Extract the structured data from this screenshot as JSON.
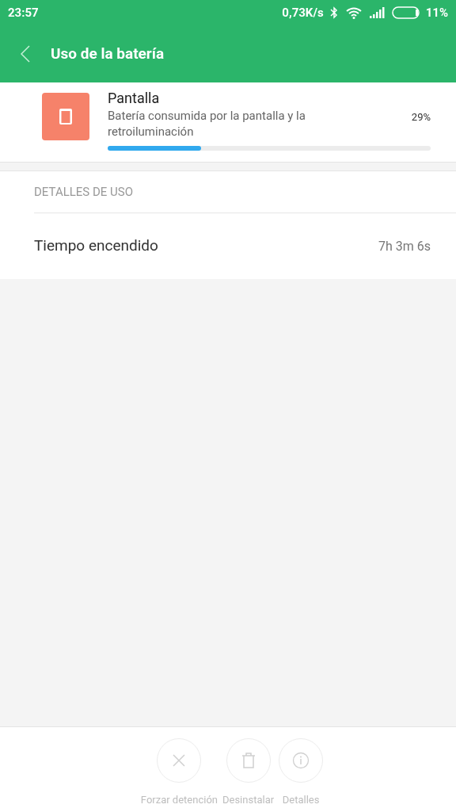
{
  "status_bar": {
    "time": "23:57",
    "speed": "0,73K/s",
    "battery": "11%"
  },
  "toolbar": {
    "title": "Uso de la batería"
  },
  "app": {
    "name": "Pantalla",
    "description": "Batería consumida por la pantalla y la retroiluminación",
    "percent": "29%",
    "level": 0.29
  },
  "details": {
    "heading": "DETALLES DE USO",
    "rows": [
      {
        "label": "Tiempo encendido",
        "value": "7h 3m 6s"
      }
    ]
  },
  "actions": [
    {
      "kind": "stop",
      "label": "Forzar detención",
      "disabled": true
    },
    {
      "kind": "uninstall",
      "label": "Desinstalar",
      "disabled": true
    },
    {
      "kind": "info",
      "label": "Detalles",
      "disabled": true
    }
  ]
}
